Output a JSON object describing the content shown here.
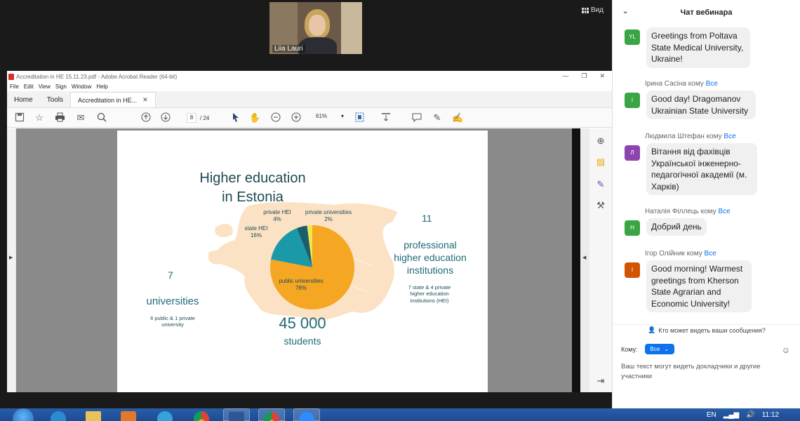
{
  "zoom": {
    "speaker_name": "Liia Lauri",
    "view_label": "Вид"
  },
  "acrobat": {
    "window_title": "Accreditation in HE 15.11.23.pdf - Adobe Acrobat Reader (64-bit)",
    "menu": [
      "File",
      "Edit",
      "View",
      "Sign",
      "Window",
      "Help"
    ],
    "tabs": {
      "home": "Home",
      "tools": "Tools",
      "doc": "Accreditation in HE..."
    },
    "page_current": "8",
    "page_total": "/ 24",
    "zoom_level": "61%"
  },
  "slide": {
    "title_line1": "Higher education",
    "title_line2": "in Estonia",
    "universities_count": "7",
    "universities_label": "universities",
    "universities_detail_line1": "6 public & 1 private",
    "universities_detail_line2": "university",
    "professional_count": "11",
    "professional_label_line1": "professional",
    "professional_label_line2": "higher education",
    "professional_label_line3": "institutions",
    "professional_detail_line1": "7 state & 4 private",
    "professional_detail_line2": "higher education",
    "professional_detail_line3": "institutions (HEI)",
    "students_count": "45 000",
    "students_label": "students",
    "pie_labels": {
      "private_hei": "private HEI",
      "private_hei_pct": "4%",
      "private_univ": "private universities",
      "private_univ_pct": "2%",
      "state_hei": "state HEI",
      "state_hei_pct": "16%",
      "public_univ": "public universities",
      "public_univ_pct": "78%"
    },
    "pie": [
      {
        "name": "public universities",
        "value": 78,
        "color": "#f5a623"
      },
      {
        "name": "state HEI",
        "value": 16,
        "color": "#1a9aa8"
      },
      {
        "name": "private HEI",
        "value": 4,
        "color": "#1d5e6e"
      },
      {
        "name": "private universities",
        "value": 2,
        "color": "#f2e64a"
      }
    ]
  },
  "chat": {
    "title": "Чат вебинара",
    "messages": [
      {
        "sender": "",
        "to": "",
        "avatar": "YL",
        "avatar_color": "#3aa544",
        "lines": [
          "Greetings from Poltava",
          "State Medical University,",
          "Ukraine!"
        ]
      },
      {
        "sender": "Ірина Сасіна кому",
        "to": "Все",
        "avatar": "І",
        "avatar_color": "#3aa544",
        "lines": [
          "Good day! Dragomanov",
          "Ukrainian State University"
        ]
      },
      {
        "sender": "Людмила Штефан кому",
        "to": "Все",
        "avatar": "Л",
        "avatar_color": "#8e44ad",
        "lines": [
          "Вітання від фахівців",
          "Української інженерно-",
          "педагогічної академії (м.",
          "Харків)"
        ]
      },
      {
        "sender": "Наталія Філлець кому",
        "to": "Все",
        "avatar": "Н",
        "avatar_color": "#3aa544",
        "lines": [
          "Добрий день"
        ]
      },
      {
        "sender": "Ігор Олійник кому",
        "to": "Все",
        "avatar": "І",
        "avatar_color": "#d35400",
        "lines": [
          "Good morning! Warmest",
          "greetings from Kherson",
          "State Agrarian and",
          "Economic University!"
        ]
      }
    ],
    "who_sees": "Кто может видеть ваши сообщения?",
    "to_label": "Кому:",
    "to_value": "Все",
    "hint": "Ваш текст могут видеть докладчики и другие участники"
  },
  "taskbar": {
    "lang": "EN",
    "time": "11:12"
  }
}
